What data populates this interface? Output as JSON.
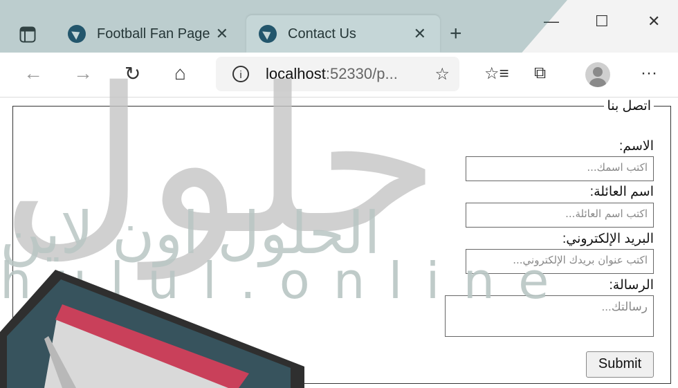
{
  "browser": {
    "tabs": [
      {
        "title": "Football Fan Page",
        "active": false
      },
      {
        "title": "Contact Us",
        "active": true
      }
    ],
    "address": {
      "host": "localhost",
      "rest": ":52330/p..."
    }
  },
  "form": {
    "legend": "اتصل بنا",
    "first_name": {
      "label": "الاسم:",
      "placeholder": "اكتب اسمك..."
    },
    "last_name": {
      "label": "اسم العائلة:",
      "placeholder": "اكتب اسم العائلة..."
    },
    "email": {
      "label": "البريد الإلكتروني:",
      "placeholder": "اكتب عنوان بريدك الإلكتروني..."
    },
    "message": {
      "label": "الرسالة:",
      "placeholder": "رسالتك..."
    },
    "submit": "Submit"
  },
  "watermark": {
    "logo": "حلول",
    "arabic": "الحلول اون لاين",
    "latin": "hulul.online"
  },
  "colors": {
    "watermark_gray": "#c4c4c4",
    "watermark_teal": "#b9c6c4",
    "tab_active": "#ffffff"
  }
}
